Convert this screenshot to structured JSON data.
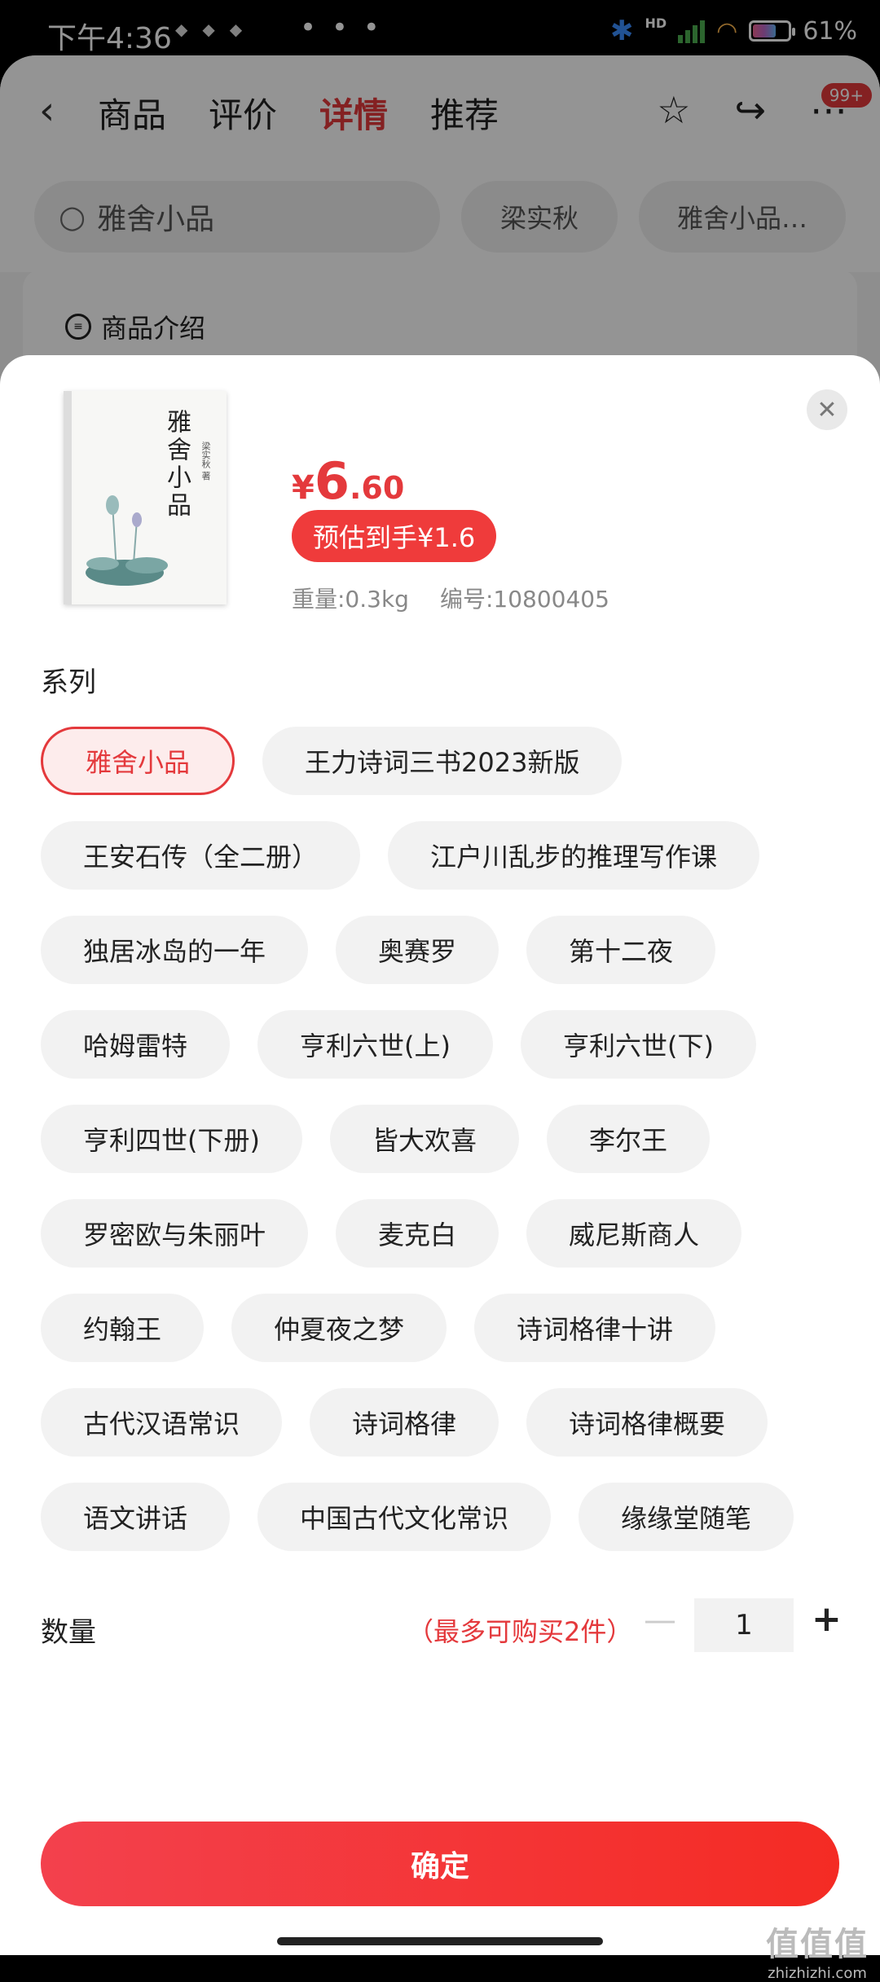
{
  "status_bar": {
    "time": "下午4:36",
    "more": "• • •",
    "battery": "61%"
  },
  "nav": {
    "tabs": [
      "商品",
      "评价",
      "详情",
      "推荐"
    ],
    "active_tab": "详情",
    "badge": "99+"
  },
  "search": {
    "placeholder": "雅舍小品",
    "hot_words": [
      "梁实秋",
      "雅舍小品…"
    ]
  },
  "section": {
    "title": "商品介绍"
  },
  "product": {
    "cover_title": "雅舍小品",
    "cover_author": "梁实秋 著",
    "price_symbol": "¥",
    "price_int": "6",
    "price_dec": ".60",
    "estimated": "预估到手¥1.6",
    "weight": "重量:0.3kg",
    "sku": "编号:10800405"
  },
  "series": {
    "label": "系列",
    "selected": "雅舍小品",
    "options": [
      "雅舍小品",
      "王力诗词三书2023新版",
      "王安石传（全二册）",
      "江户川乱步的推理写作课",
      "独居冰岛的一年",
      "奥赛罗",
      "第十二夜",
      "哈姆雷特",
      "亨利六世(上)",
      "亨利六世(下)",
      "亨利四世(下册)",
      "皆大欢喜",
      "李尔王",
      "罗密欧与朱丽叶",
      "麦克白",
      "威尼斯商人",
      "约翰王",
      "仲夏夜之梦",
      "诗词格律十讲",
      "古代汉语常识",
      "诗词格律",
      "诗词格律概要",
      "语文讲话",
      "中国古代文化常识",
      "缘缘堂随笔"
    ]
  },
  "quantity": {
    "label": "数量",
    "limit": "（最多可购买2件）",
    "minus": "—",
    "value": "1",
    "plus": "+"
  },
  "confirm_label": "确定",
  "watermark": {
    "logo": "值值值",
    "url": "zhizhizhi.com"
  },
  "colors": {
    "accent": "#e4393c",
    "chip_bg": "#f2f2f2",
    "selected_bg": "#fdecec"
  }
}
